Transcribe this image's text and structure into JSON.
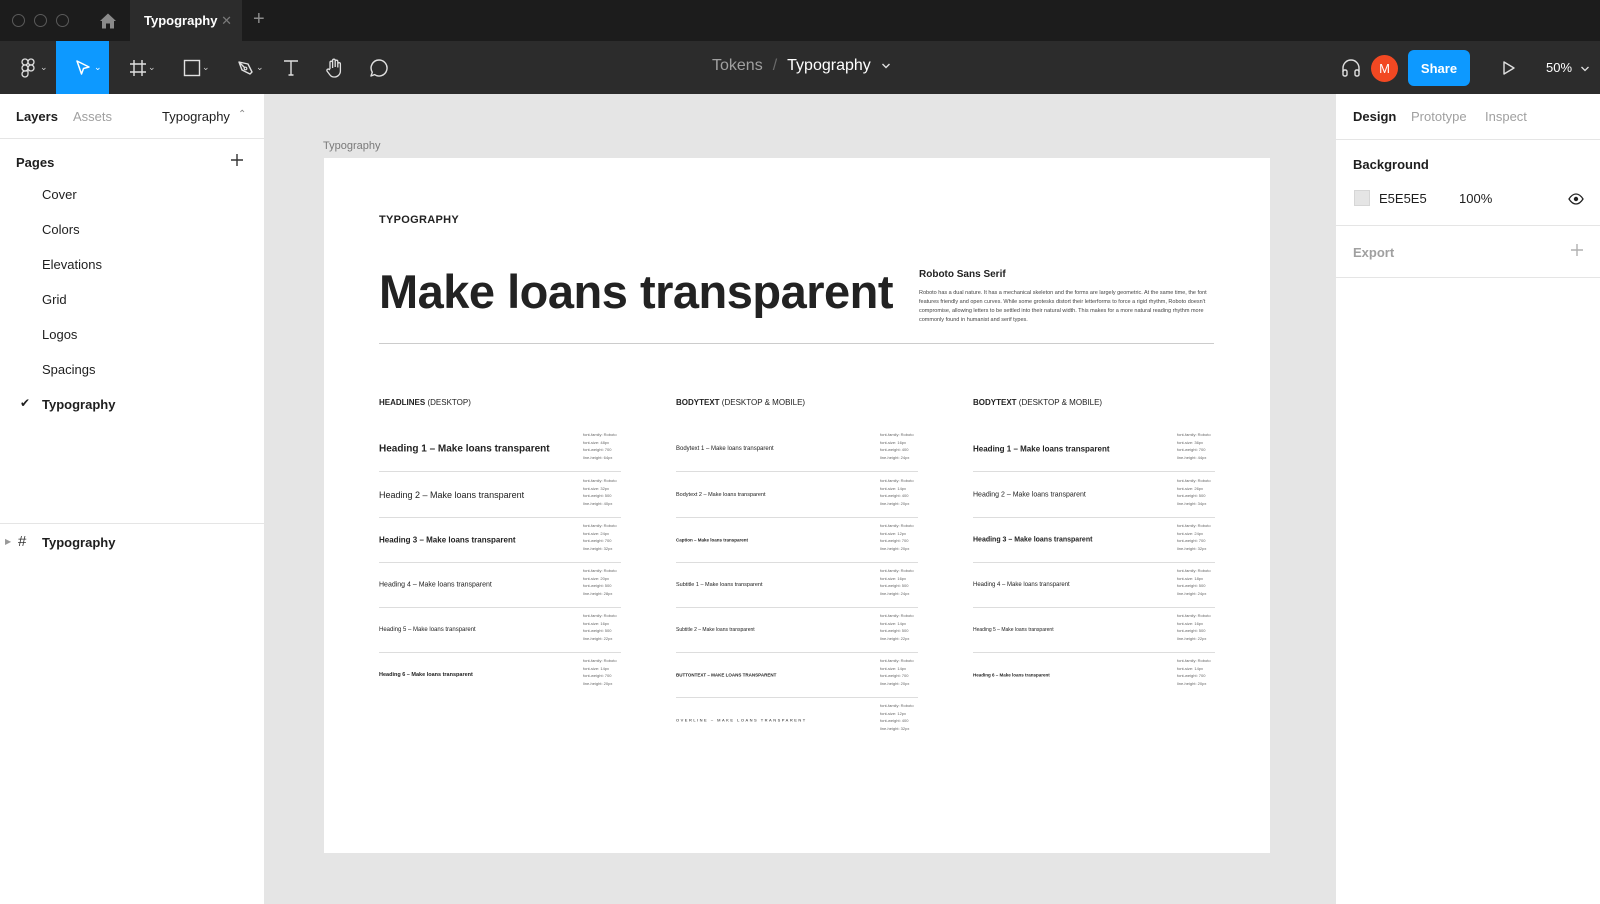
{
  "titlebar": {
    "tab_label": "Typography",
    "tab_close": "✕",
    "tab_add": "+"
  },
  "toolbar": {
    "breadcrumb_parent": "Tokens",
    "breadcrumb_separator": "/",
    "breadcrumb_current": "Typography",
    "avatar_initial": "M",
    "share_label": "Share",
    "zoom_label": "50%"
  },
  "left_panel": {
    "tabs": [
      "Layers",
      "Assets"
    ],
    "page_selector": "Typography",
    "pages_header": "Pages",
    "pages": [
      "Cover",
      "Colors",
      "Elevations",
      "Grid",
      "Logos",
      "Spacings",
      "Typography"
    ],
    "current_page": "Typography",
    "layer_name": "Typography"
  },
  "canvas": {
    "frame_label": "Typography",
    "eyebrow": "TYPOGRAPHY",
    "hero": "Make loans transparent",
    "font_title": "Roboto Sans Serif",
    "font_desc": "Roboto has a dual nature. It has a mechanical skeleton and the forms are largely geometric. At the same time, the font features friendly and open curves. While some grotesks distort their letterforms to force a rigid rhythm, Roboto doesn't compromise, allowing letters to be settled into their natural width. This makes for a more natural reading rhythm more commonly found in humanist and serif types.",
    "columns": [
      {
        "header_bold": "HEADLINES",
        "header_rest": "(DESKTOP)",
        "rows": [
          {
            "sample": "Heading 1 – Make loans transparent",
            "meta": "font-family: Roboto\nfont-size: 48px\nfont-weight: 700\nline-height: 64px"
          },
          {
            "sample": "Heading 2 – Make loans transparent",
            "meta": "font-family: Roboto\nfont-size: 32px\nfont-weight: 500\nline-height: 40px"
          },
          {
            "sample": "Heading 3 – Make loans transparent",
            "meta": "font-family: Roboto\nfont-size: 24px\nfont-weight: 700\nline-height: 32px"
          },
          {
            "sample": "Heading 4 – Make loans transparent",
            "meta": "font-family: Roboto\nfont-size: 20px\nfont-weight: 500\nline-height: 28px"
          },
          {
            "sample": "Heading 5 – Make loans transparent",
            "meta": "font-family: Roboto\nfont-size: 16px\nfont-weight: 500\nline-height: 22px"
          },
          {
            "sample": "Heading 6 – Make loans transparent",
            "meta": "font-family: Roboto\nfont-size: 14px\nfont-weight: 700\nline-height: 20px"
          }
        ]
      },
      {
        "header_bold": "BODYTEXT",
        "header_rest": "(DESKTOP & MOBILE)",
        "rows": [
          {
            "sample": "Bodytext 1 – Make loans transparent",
            "meta": "font-family: Roboto\nfont-size: 16px\nfont-weight: 400\nline-height: 24px"
          },
          {
            "sample": "Bodytext 2 – Make loans transparent",
            "meta": "font-family: Roboto\nfont-size: 14px\nfont-weight: 400\nline-height: 20px"
          },
          {
            "sample": "Caption – Make loans transparent",
            "meta": "font-family: Roboto\nfont-size: 12px\nfont-weight: 700\nline-height: 20px"
          },
          {
            "sample": "Subtitle 1 – Make loans transparent",
            "meta": "font-family: Roboto\nfont-size: 16px\nfont-weight: 500\nline-height: 24px"
          },
          {
            "sample": "Subtitle 2 – Make loans transparent",
            "meta": "font-family: Roboto\nfont-size: 14px\nfont-weight: 500\nline-height: 22px"
          },
          {
            "sample": "BUTTONTEXT – MAKE LOANS TRANSPARENT",
            "meta": "font-family: Roboto\nfont-size: 14px\nfont-weight: 700\nline-height: 20px"
          },
          {
            "sample": "OVERLINE – MAKE LOANS TRANSPARENT",
            "meta": "font-family: Roboto\nfont-size: 12px\nfont-weight: 400\nline-height: 32px"
          }
        ]
      },
      {
        "header_bold": "BODYTEXT",
        "header_rest": "(DESKTOP & MOBILE)",
        "rows": [
          {
            "sample": "Heading 1 – Make loans transparent",
            "meta": "font-family: Roboto\nfont-size: 36px\nfont-weight: 700\nline-height: 44px"
          },
          {
            "sample": "Heading 2 – Make loans transparent",
            "meta": "font-family: Roboto\nfont-size: 26px\nfont-weight: 500\nline-height: 34px"
          },
          {
            "sample": "Heading 3 – Make loans transparent",
            "meta": "font-family: Roboto\nfont-size: 24px\nfont-weight: 700\nline-height: 32px"
          },
          {
            "sample": "Heading 4 – Make loans transparent",
            "meta": "font-family: Roboto\nfont-size: 18px\nfont-weight: 500\nline-height: 24px"
          },
          {
            "sample": "Heading 5 – Make loans transparent",
            "meta": "font-family: Roboto\nfont-size: 16px\nfont-weight: 500\nline-height: 22px"
          },
          {
            "sample": "Heading 6 – Make loans transparent",
            "meta": "font-family: Roboto\nfont-size: 14px\nfont-weight: 700\nline-height: 20px"
          }
        ]
      }
    ]
  },
  "right_panel": {
    "tabs": [
      "Design",
      "Prototype",
      "Inspect"
    ],
    "background_title": "Background",
    "background_hex": "E5E5E5",
    "background_opacity": "100%",
    "export_title": "Export",
    "export_add": "+"
  },
  "colors": {
    "accent": "#0d99ff",
    "avatar": "#f24822",
    "toolbar": "#2c2c2c",
    "canvas_bg": "#e5e5e5"
  }
}
